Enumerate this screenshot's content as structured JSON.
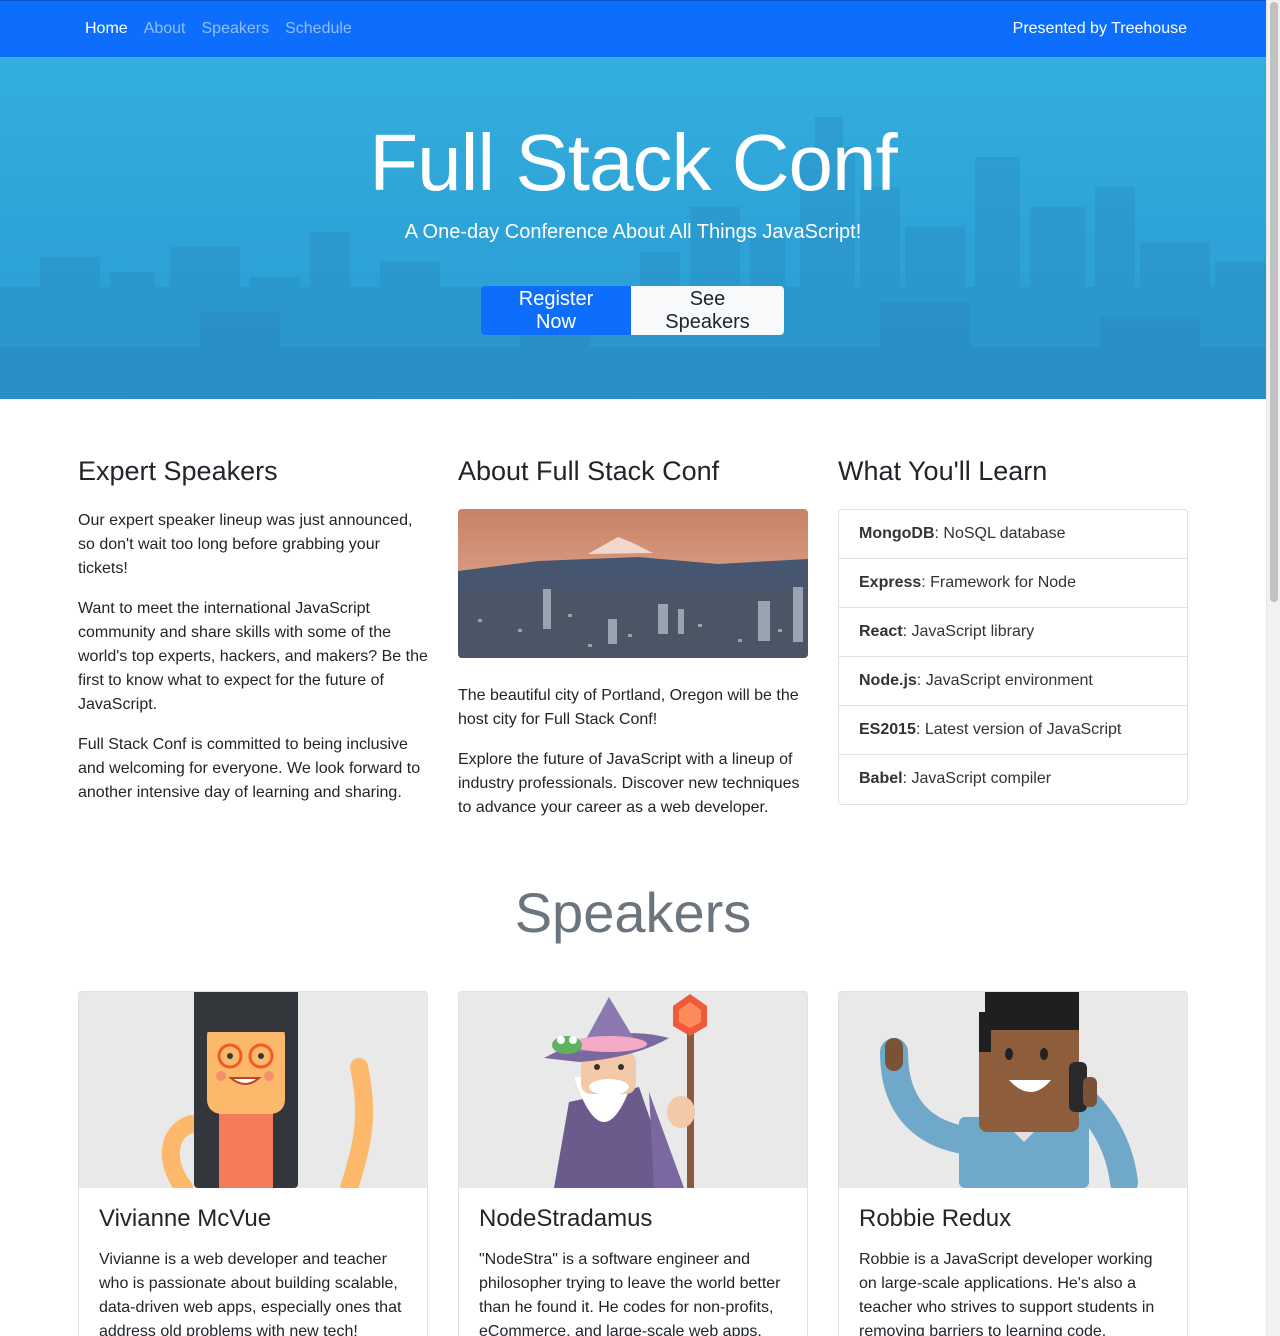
{
  "nav": {
    "links": [
      {
        "label": "Home"
      },
      {
        "label": "About"
      },
      {
        "label": "Speakers"
      },
      {
        "label": "Schedule"
      }
    ],
    "presented_by": "Presented by Treehouse"
  },
  "hero": {
    "title": "Full Stack Conf",
    "subtitle": "A One-day Conference About All Things JavaScript!",
    "register_label": "Register Now",
    "see_speakers_label": "See Speakers"
  },
  "expert": {
    "heading": "Expert Speakers",
    "paragraphs": [
      "Our expert speaker lineup was just announced, so don't wait too long before grabbing your tickets!",
      "Want to meet the international JavaScript community and share skills with some of the world's top experts, hackers, and makers? Be the first to know what to expect for the future of JavaScript.",
      "Full Stack Conf is committed to being inclusive and welcoming for everyone. We look forward to another intensive day of learning and sharing."
    ]
  },
  "about": {
    "heading": "About Full Stack Conf",
    "paragraphs": [
      "The beautiful city of Portland, Oregon will be the host city for Full Stack Conf!",
      "Explore the future of JavaScript with a lineup of industry professionals. Discover new techniques to advance your career as a web developer."
    ]
  },
  "learn": {
    "heading": "What You'll Learn",
    "items": [
      {
        "name": "MongoDB",
        "desc": ": NoSQL database"
      },
      {
        "name": "Express",
        "desc": ": Framework for Node"
      },
      {
        "name": "React",
        "desc": ": JavaScript library"
      },
      {
        "name": "Node.js",
        "desc": ": JavaScript environment"
      },
      {
        "name": "ES2015",
        "desc": ": Latest version of JavaScript"
      },
      {
        "name": "Babel",
        "desc": ": JavaScript compiler"
      }
    ]
  },
  "speakers": {
    "heading": "Speakers",
    "cards": [
      {
        "name": "Vivianne McVue",
        "bio": "Vivianne is a web developer and teacher who is passionate about building scalable, data-driven web apps, especially ones that address old problems with new tech!"
      },
      {
        "name": "NodeStradamus",
        "bio": "\"NodeStra\" is a software engineer and philosopher trying to leave the world better than he found it. He codes for non-profits, eCommerce, and large-scale web apps."
      },
      {
        "name": "Robbie Redux",
        "bio": "Robbie is a JavaScript developer working on large-scale applications. He's also a teacher who strives to support students in removing barriers to learning code."
      }
    ]
  }
}
